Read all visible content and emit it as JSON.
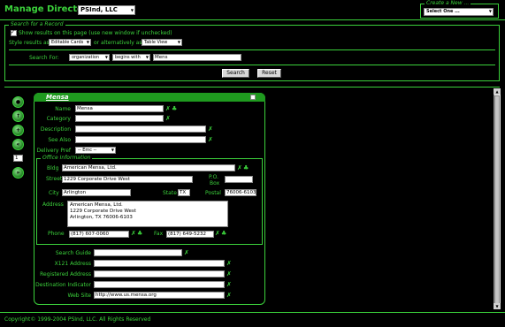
{
  "header": {
    "title": "Manage Directory",
    "org_select": "PSInd, LLC",
    "create_legend": "Create a New ...",
    "create_select": "Select One ..."
  },
  "search": {
    "legend": "Search for a Record",
    "new_window_label": "Show results on this page (use new window if unchecked)",
    "style_label": "Style results as",
    "style_select": "Editable Cards",
    "or_label": "or alternatively as",
    "view_select": "Table View",
    "search_for_label": "Search For:",
    "type_select": "organization",
    "match_select": "begins with",
    "query_value": "Mens",
    "search_button": "Search",
    "reset_button": "Reset"
  },
  "sidebar": {
    "page_number": "1"
  },
  "card": {
    "title": "Mensa",
    "fields": {
      "name_label": "Name",
      "name_value": "Mensa",
      "category_label": "Category",
      "description_label": "Description",
      "see_also_label": "See Also",
      "delivery_label": "Delivery Pref",
      "delivery_value": "-- Emc --"
    },
    "office": {
      "legend": "Office Information",
      "bldg_label": "Bldg",
      "bldg_value": "American Mensa, Ltd.",
      "street_label": "Street",
      "street_value": "1229 Corporate Drive West",
      "po_label": "P.O.",
      "box_label": "Box",
      "city_label": "City",
      "city_value": "Arlington",
      "state_label": "State",
      "state_value": "TX",
      "postal_label": "Postal",
      "postal_value": "76006-6103",
      "address_label": "Address",
      "address_line1": "American Mensa, Ltd.",
      "address_line2": "1229 Corporate Drive West",
      "address_line3": "Arlington, TX 76006-6103",
      "phone_label": "Phone",
      "phone_value": "(817) 607-0060",
      "fax_label": "Fax",
      "fax_value": "(817) 649-5232"
    },
    "extra": {
      "search_guide_label": "Search Guide",
      "x121_label": "X121 Address",
      "registered_label": "Registered Address",
      "destination_label": "Destination Indicator",
      "website_label": "Web Site",
      "website_value": "http://www.us.mensa.org"
    }
  },
  "footer": {
    "copyright": "Copyright© 1999-2004 PSInd, LLC. All Rights Reserved"
  },
  "colors": {
    "accent": "#3bd13b",
    "background": "#000000",
    "card_header": "#1f9a1f"
  }
}
